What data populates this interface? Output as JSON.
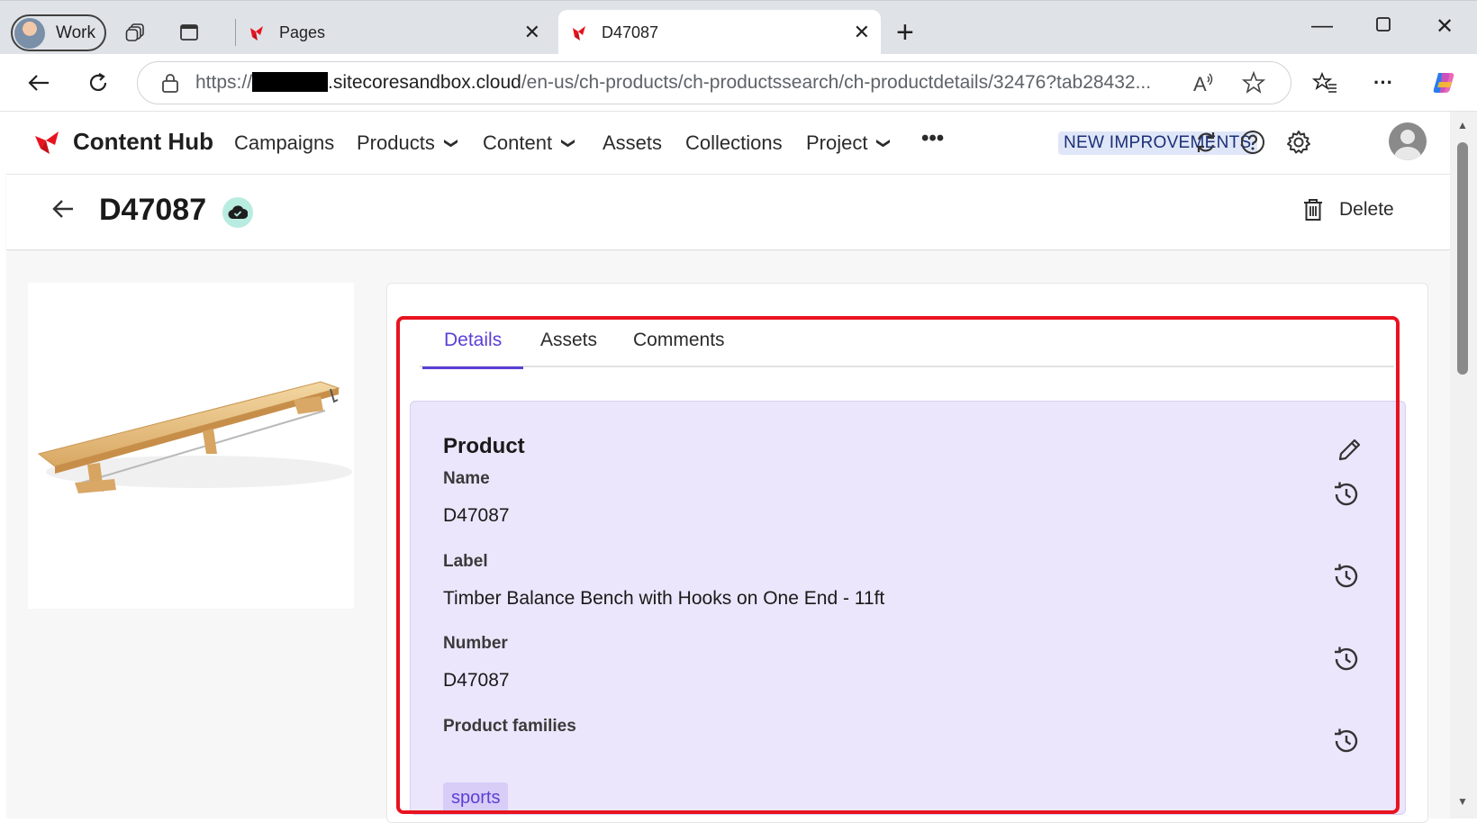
{
  "browser": {
    "profile_label": "Work",
    "tabs": [
      {
        "title": "Pages"
      },
      {
        "title": "D47087"
      }
    ],
    "url_prefix": "https://",
    "url_host": ".sitecoresandbox.cloud",
    "url_path": "/en-us/ch-products/ch-productssearch/ch-productdetails/32476?tab28432..."
  },
  "app": {
    "brand_name": "Content Hub",
    "menu": [
      {
        "label": "Campaigns"
      },
      {
        "label": "Products"
      },
      {
        "label": "Content"
      },
      {
        "label": "Assets"
      },
      {
        "label": "Collections"
      },
      {
        "label": "Project"
      }
    ],
    "new_improvements_label": "NEW IMPROVEMENTS",
    "accent_color": "#5b3fd6",
    "brand_color": "#e8131f"
  },
  "page": {
    "title": "D47087",
    "delete_label": "Delete",
    "tabs": [
      {
        "label": "Details"
      },
      {
        "label": "Assets"
      },
      {
        "label": "Comments"
      }
    ],
    "section_title": "Product",
    "fields": [
      {
        "label": "Name",
        "value": "D47087"
      },
      {
        "label": "Label",
        "value": "Timber Balance Bench with Hooks on One End - 11ft"
      },
      {
        "label": "Number",
        "value": "D47087"
      },
      {
        "label": "Product families",
        "value": "sports"
      }
    ]
  }
}
